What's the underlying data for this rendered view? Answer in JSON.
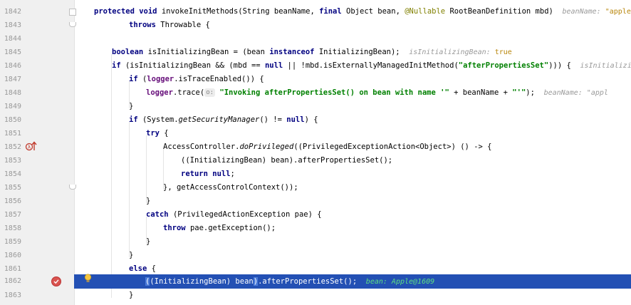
{
  "editor": {
    "lines": [
      {
        "num": "1842"
      },
      {
        "num": "1843"
      },
      {
        "num": "1844"
      },
      {
        "num": "1845"
      },
      {
        "num": "1846"
      },
      {
        "num": "1847"
      },
      {
        "num": "1848"
      },
      {
        "num": "1849"
      },
      {
        "num": "1850"
      },
      {
        "num": "1851"
      },
      {
        "num": "1852"
      },
      {
        "num": "1853"
      },
      {
        "num": "1854"
      },
      {
        "num": "1855"
      },
      {
        "num": "1856"
      },
      {
        "num": "1857"
      },
      {
        "num": "1858"
      },
      {
        "num": "1859"
      },
      {
        "num": "1860"
      },
      {
        "num": "1861"
      },
      {
        "num": "1862"
      },
      {
        "num": "1863"
      }
    ],
    "code": {
      "l1842": {
        "kw1": "protected void ",
        "sig": "invokeInitMethods(String beanName, ",
        "kw2": "final ",
        "sig2": "Object bean, ",
        "ann": "@Nullable ",
        "sig3": "RootBeanDefinition mbd)",
        "hint_name": "beanName: ",
        "hint_val": "\"apple\""
      },
      "l1843": {
        "kw": "throws ",
        "rest": "Throwable {"
      },
      "l1845": {
        "kw": "boolean ",
        "rest": "isInitializingBean = (bean ",
        "kw2": "instanceof ",
        "rest2": "InitializingBean);",
        "hint_name": "isInitializingBean: ",
        "hint_val": "true"
      },
      "l1846": {
        "kw": "if ",
        "a": "(isInitializingBean && (mbd == ",
        "kw2": "null ",
        "b": "|| !mbd.isExternallyManagedInitMethod(",
        "str": "\"afterPropertiesSet\"",
        "c": "))) {",
        "hint_name": "isInitializing"
      },
      "l1847": {
        "kw": "if ",
        "a": "(",
        "fld": "logger",
        ".b": "",
        "b": ".isTraceEnabled()) {"
      },
      "l1848": {
        "fld": "logger",
        "a": ".trace(",
        "phint": "o:",
        "str": "\"Invoking afterPropertiesSet() on bean with name '\"",
        "b": " + beanName + ",
        "str2": "\"'\"",
        "c": ");",
        "hint_name": "beanName: ",
        "hint_val": "\"appl"
      },
      "l1849": {
        "a": "}"
      },
      "l1850": {
        "kw": "if ",
        "a": "(System.",
        "it": "getSecurityManager",
        "b": "() != ",
        "kw2": "null",
        "c": ") {"
      },
      "l1851": {
        "kw": "try ",
        "a": "{"
      },
      "l1852": {
        "a": "AccessController.",
        "it": "doPrivileged",
        "b": "((PrivilegedExceptionAction<Object>) () -> {"
      },
      "l1853": {
        "a": "((InitializingBean) bean).afterPropertiesSet();"
      },
      "l1854": {
        "kw": "return null",
        "a": ";"
      },
      "l1855": {
        "a": "}, getAccessControlContext());"
      },
      "l1856": {
        "a": "}"
      },
      "l1857": {
        "kw": "catch ",
        "a": "(PrivilegedActionException pae) {"
      },
      "l1858": {
        "kw": "throw ",
        "a": "pae.getException();"
      },
      "l1859": {
        "a": "}"
      },
      "l1860": {
        "a": "}"
      },
      "l1861": {
        "kw": "else ",
        "a": "{"
      },
      "l1862": {
        "a": "(",
        "b": "(InitializingBean) bean",
        ")": ")",
        "c": ".afterPropertiesSet();",
        "dbg": "bean: Apple@1609"
      },
      "l1863": {
        "a": "}"
      }
    },
    "colors": {
      "keyword": "#000080",
      "field": "#660e7a",
      "string": "#008000",
      "annotation": "#808000",
      "execution_line": "#2350b4",
      "breakpoint": "#d9534f"
    },
    "icons": [
      "override-up-arrow-icon",
      "breakpoint-icon",
      "intention-bulb-icon",
      "fold-icon"
    ]
  }
}
